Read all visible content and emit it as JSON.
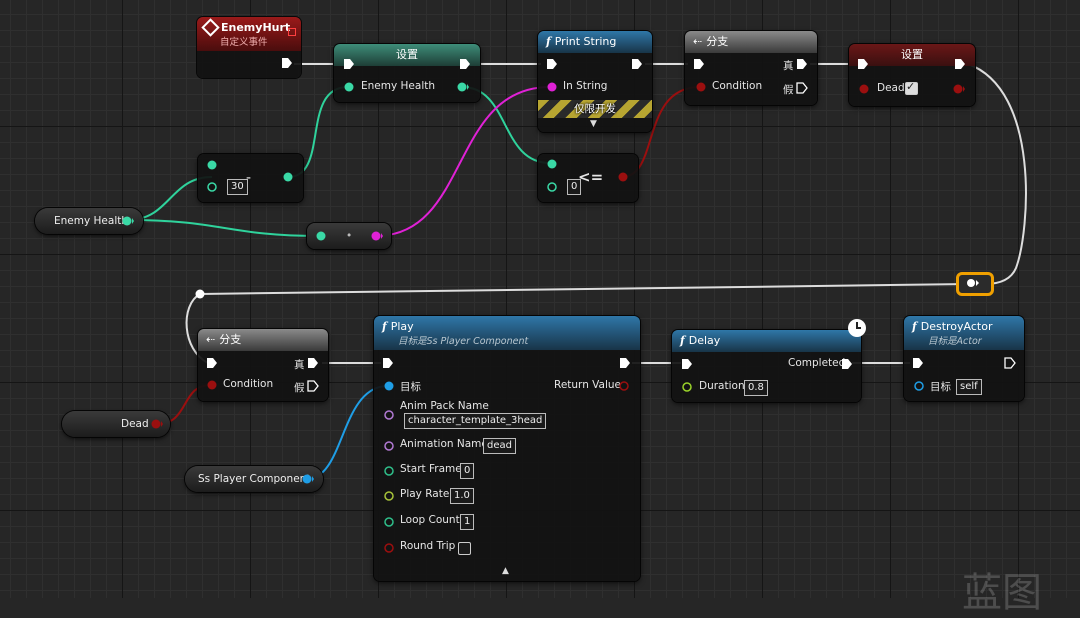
{
  "event_node": {
    "title": "EnemyHurt",
    "subtitle": "自定义事件"
  },
  "set_health": {
    "title": "设置",
    "pin_label": "Enemy Health"
  },
  "print_string": {
    "title": "Print String",
    "pin_label": "In String",
    "dev_only_label": "仅限开发"
  },
  "branch1": {
    "title": "分支",
    "condition_label": "Condition",
    "true_label": "真",
    "false_label": "假"
  },
  "set_dead": {
    "title": "设置",
    "pin_label": "Dead"
  },
  "subtract_node": {
    "value": "30",
    "op": "-"
  },
  "compare_node": {
    "value": "0",
    "op": "<="
  },
  "enemy_health_getter": {
    "label": "Enemy Health"
  },
  "convert_node": {
    "dot": "•"
  },
  "branch2": {
    "title": "分支",
    "condition_label": "Condition",
    "true_label": "真",
    "false_label": "假"
  },
  "dead_getter": {
    "label": "Dead"
  },
  "play_node": {
    "title": "Play",
    "subtitle": "目标是Ss Player Component",
    "target_label": "目标",
    "return_label": "Return Value",
    "anim_pack_label": "Anim Pack Name",
    "anim_pack_value": "character_template_3head",
    "anim_name_label": "Animation Name",
    "anim_name_value": "dead",
    "start_frame_label": "Start Frame",
    "start_frame_value": "0",
    "play_rate_label": "Play Rate",
    "play_rate_value": "1.0",
    "loop_count_label": "Loop Count",
    "loop_count_value": "1",
    "round_trip_label": "Round Trip"
  },
  "ss_getter": {
    "label": "Ss Player Component"
  },
  "delay_node": {
    "title": "Delay",
    "completed_label": "Completed",
    "duration_label": "Duration",
    "duration_value": "0.8"
  },
  "destroy_node": {
    "title": "DestroyActor",
    "subtitle": "目标是Actor",
    "target_label": "目标",
    "target_value": "self"
  },
  "watermark": "蓝图",
  "pin_colors": {
    "exec": "#ffffff",
    "float": "#3ad9a6",
    "bool": "#9b0f0f",
    "string": "#e021d6",
    "object": "#1f9ee6",
    "name": "#b27ad4",
    "int": "#2fbf8a",
    "float_play": "#a8c43a",
    "delay_float": "#9bd42a",
    "reroute": "#f0a000"
  }
}
